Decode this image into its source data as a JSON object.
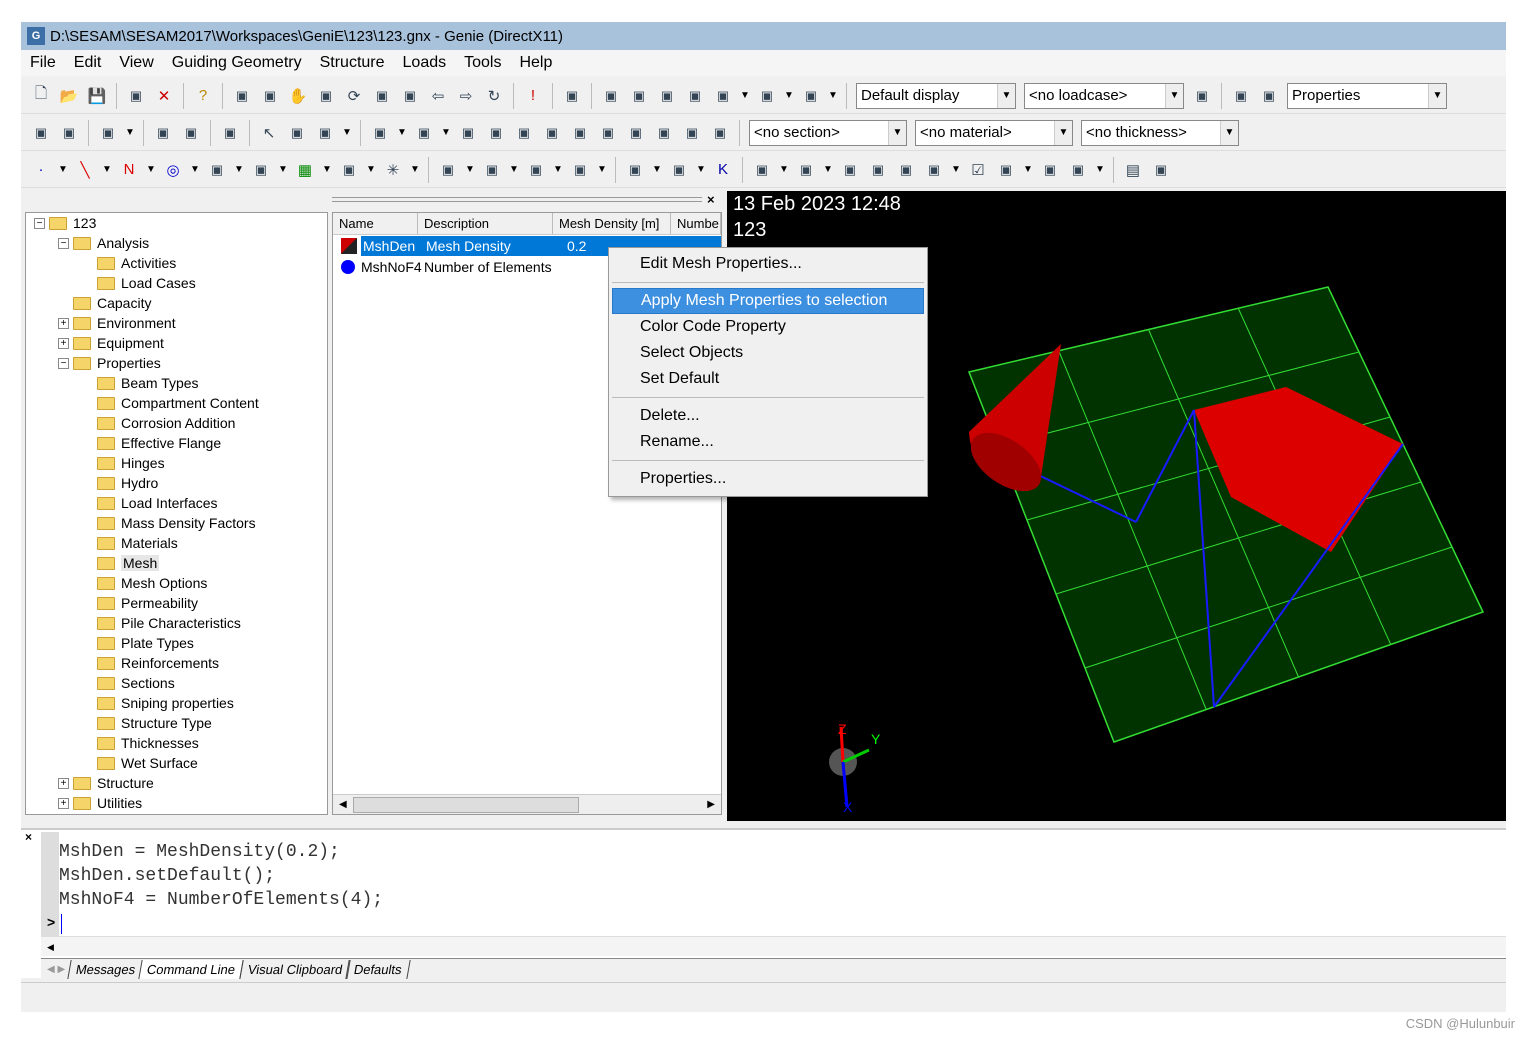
{
  "window": {
    "title": "D:\\SESAM\\SESAM2017\\Workspaces\\GeniE\\123\\123.gnx - Genie (DirectX11)",
    "icon": "genie-app-icon"
  },
  "menubar": [
    "File",
    "Edit",
    "View",
    "Guiding Geometry",
    "Structure",
    "Loads",
    "Tools",
    "Help"
  ],
  "toolbar1": {
    "icons": [
      "new-file-icon",
      "open-folder-icon",
      "save-icon",
      "|",
      "copy-icon",
      "delete-icon",
      "|",
      "help-icon",
      "|",
      "orbit-icon",
      "pan-down-icon",
      "hand-pan-icon",
      "zoom-window-icon",
      "rotate-icon",
      "zoom-fit-icon",
      "zoom-selected-icon",
      "previous-view-icon",
      "next-view-icon",
      "refresh-icon",
      "|",
      "warning-icon",
      "|",
      "paint-brush-icon",
      "|",
      "view-iso-icon",
      "view-front-icon",
      "view-right-icon",
      "view-top-icon",
      "view-special-icon",
      "dropdown",
      "view-solid-icon",
      "dropdown",
      "sketch-icon",
      "dropdown"
    ],
    "display": "Default display",
    "loadcase": "<no loadcase>",
    "icons2": [
      "loadcase-icon",
      "|",
      "properties-brush-icon",
      "property-list-icon"
    ],
    "properties": "Properties"
  },
  "toolbar2": {
    "icons": [
      "select-node-icon",
      "select-multi-icon",
      "|",
      "select-filter-icon",
      "dropdown",
      "|",
      "undo-select-icon",
      "clear-select-icon",
      "|",
      "report-icon",
      "|",
      "pointer-icon",
      "lasso-icon",
      "select-box-icon",
      "dropdown",
      "|",
      "beam-select-icon",
      "dropdown",
      "plate-select-icon",
      "dropdown",
      "grid-select-icon",
      "point-select-icon",
      "support-select-icon",
      "k-select-icon",
      "solid-select-icon",
      "profile-select-icon",
      "load-select-icon",
      "panel-select-icon",
      "joint-select-icon",
      "mesh-select-icon"
    ],
    "section": "<no section>",
    "material": "<no material>",
    "thickness": "<no thickness>"
  },
  "toolbar3": {
    "icons": [
      "point-icon",
      "dropdown",
      "line-icon",
      "dropdown",
      "polyline-icon",
      "dropdown",
      "circle-icon",
      "dropdown",
      "curve-icon",
      "dropdown",
      "intersect-icon",
      "dropdown",
      "grid-icon",
      "dropdown",
      "surface-icon",
      "dropdown",
      "axes-icon",
      "dropdown",
      "|",
      "plate-icon",
      "dropdown",
      "panel-icon",
      "dropdown",
      "pile-icon",
      "dropdown",
      "hinge-icon",
      "dropdown",
      "|",
      "support-icon",
      "dropdown",
      "spring-icon",
      "dropdown",
      "k-icon",
      "|",
      "split-icon",
      "dropdown",
      "edit-icon",
      "dropdown",
      "divide-icon",
      "divide2-icon",
      "remove-icon",
      "join-icon",
      "dropdown",
      "check-icon",
      "mesh-icon",
      "dropdown",
      "fix-icon",
      "lr-icon",
      "dropdown",
      "|",
      "table-icon",
      "analysis-icon"
    ]
  },
  "tree": [
    {
      "label": "123",
      "level": 0,
      "exp": "-"
    },
    {
      "label": "Analysis",
      "level": 1,
      "exp": "-"
    },
    {
      "label": "Activities",
      "level": 2
    },
    {
      "label": "Load Cases",
      "level": 2
    },
    {
      "label": "Capacity",
      "level": 1
    },
    {
      "label": "Environment",
      "level": 1,
      "exp": "+"
    },
    {
      "label": "Equipment",
      "level": 1,
      "exp": "+"
    },
    {
      "label": "Properties",
      "level": 1,
      "exp": "-"
    },
    {
      "label": "Beam Types",
      "level": 2
    },
    {
      "label": "Compartment Content",
      "level": 2
    },
    {
      "label": "Corrosion Addition",
      "level": 2
    },
    {
      "label": "Effective Flange",
      "level": 2
    },
    {
      "label": "Hinges",
      "level": 2
    },
    {
      "label": "Hydro",
      "level": 2
    },
    {
      "label": "Load Interfaces",
      "level": 2
    },
    {
      "label": "Mass Density Factors",
      "level": 2
    },
    {
      "label": "Materials",
      "level": 2
    },
    {
      "label": "Mesh",
      "level": 2,
      "selected": true
    },
    {
      "label": "Mesh Options",
      "level": 2
    },
    {
      "label": "Permeability",
      "level": 2
    },
    {
      "label": "Pile Characteristics",
      "level": 2
    },
    {
      "label": "Plate Types",
      "level": 2
    },
    {
      "label": "Reinforcements",
      "level": 2
    },
    {
      "label": "Sections",
      "level": 2
    },
    {
      "label": "Sniping properties",
      "level": 2
    },
    {
      "label": "Structure Type",
      "level": 2
    },
    {
      "label": "Thicknesses",
      "level": 2
    },
    {
      "label": "Wet Surface",
      "level": 2
    },
    {
      "label": "Structure",
      "level": 1,
      "exp": "+"
    },
    {
      "label": "Utilities",
      "level": 1,
      "exp": "+"
    }
  ],
  "list": {
    "columns": [
      "Name",
      "Description",
      "Mesh Density [m]",
      "Numbe"
    ],
    "rows": [
      {
        "icon": "mesh-density-icon",
        "name": "MshDen",
        "description": "Mesh Density",
        "density": "0.2",
        "selected": true
      },
      {
        "icon": "blue-circle-icon",
        "name": "MshNoF4",
        "description": "Number of Elements",
        "density": ""
      }
    ]
  },
  "view": {
    "datetime": "13 Feb 2023 12:48",
    "model": "123",
    "axes": [
      "Z",
      "Y",
      "X"
    ]
  },
  "context_menu": [
    {
      "label": "Edit Mesh Properties..."
    },
    {
      "sep": true
    },
    {
      "label": "Apply Mesh Properties to selection",
      "highlighted": true
    },
    {
      "label": "Color Code Property"
    },
    {
      "label": "Select Objects"
    },
    {
      "label": "Set Default"
    },
    {
      "sep": true
    },
    {
      "label": "Delete..."
    },
    {
      "label": "Rename..."
    },
    {
      "sep": true
    },
    {
      "label": "Properties..."
    }
  ],
  "console": {
    "lines": [
      "MshDen = MeshDensity(0.2);",
      "MshDen.setDefault();",
      "MshNoF4 = NumberOfElements(4);"
    ],
    "prompt": ">",
    "tabs": [
      "Messages",
      "Command Line",
      "Visual Clipboard",
      "Defaults"
    ],
    "active_tab": "Command Line"
  },
  "watermark": "CSDN @Hulunbuir",
  "colors": {
    "selection": "#0078d7",
    "menu_highlight": "#3d8fe0",
    "plate": "#003300",
    "grid": "#33dd33",
    "red": "#dd0000",
    "beam": "#1a1aff"
  }
}
